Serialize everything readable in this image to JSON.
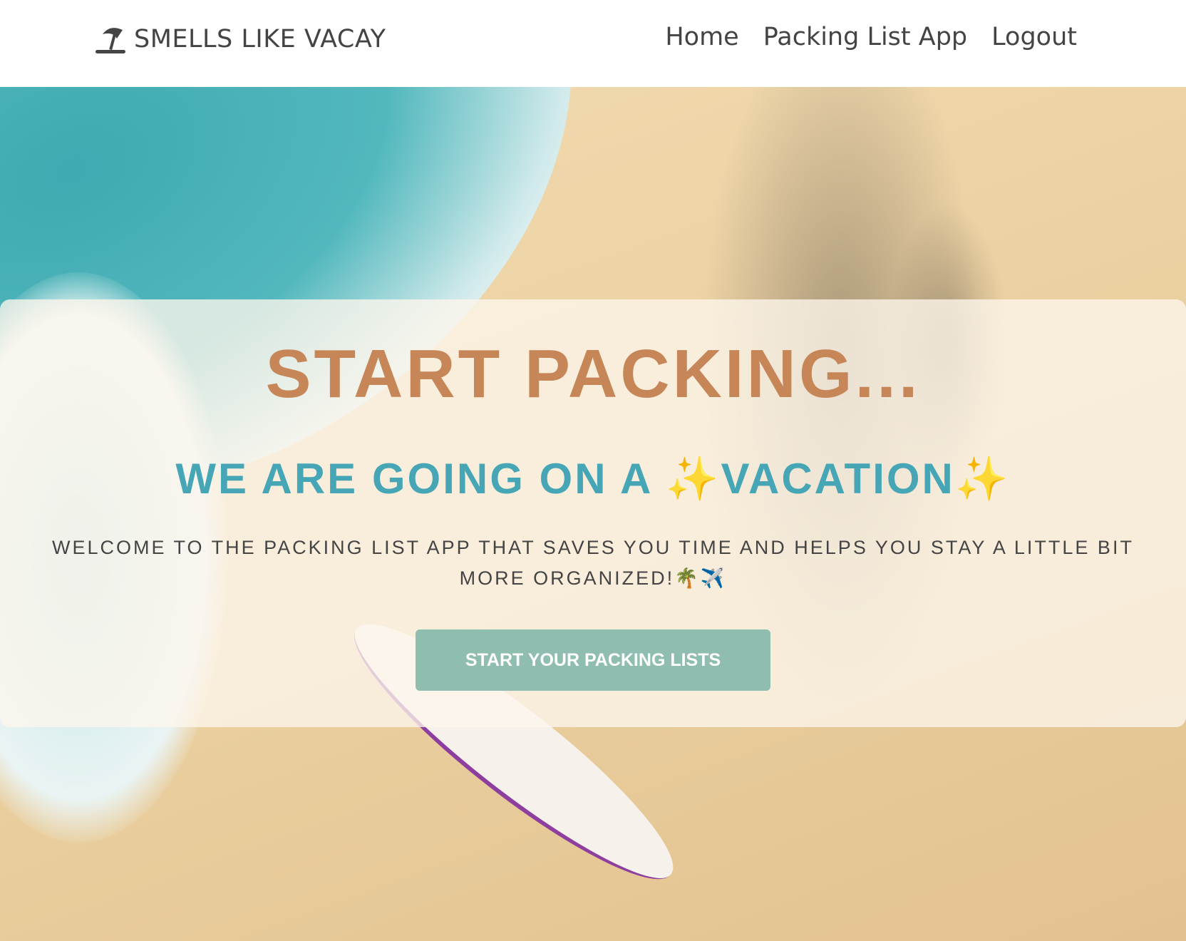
{
  "nav": {
    "brand": "SMELLS LIKE VACAY",
    "brand_icon": "beach-umbrella-icon",
    "links": [
      "Home",
      "Packing List App",
      "Logout"
    ]
  },
  "hero": {
    "title": "START PACKING...",
    "subtitle": "WE ARE GOING ON A ✨VACATION✨",
    "welcome": "WELCOME TO THE PACKING LIST APP THAT SAVES YOU TIME AND HELPS YOU STAY A LITTLE BIT MORE ORGANIZED!🌴✈️",
    "cta": "START YOUR PACKING LISTS"
  },
  "colors": {
    "title": "#c68658",
    "subtitle": "#46a6b6",
    "button": "#8fbdaf"
  }
}
